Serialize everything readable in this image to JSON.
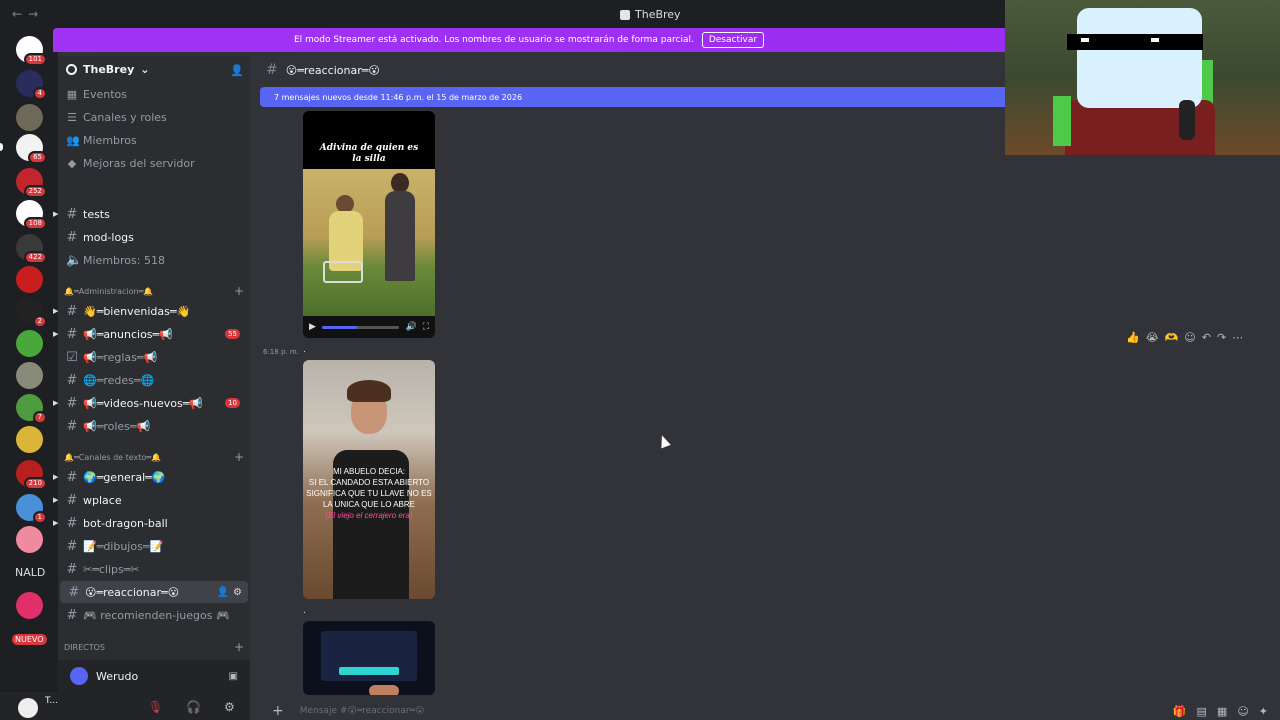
{
  "window": {
    "title": "TheBrey",
    "back_arrow": "←",
    "forward_arrow": "→"
  },
  "banner": {
    "text": "El modo Streamer está activado. Los nombres de usuario se mostrarán de forma parcial.",
    "button": "Desactivar",
    "color": "#a033f4"
  },
  "server": {
    "name": "TheBrey"
  },
  "menu": [
    {
      "label": "Eventos",
      "icon": "calendar-icon"
    },
    {
      "label": "Canales y roles",
      "icon": "list-icon"
    },
    {
      "label": "Miembros",
      "icon": "members-icon"
    },
    {
      "label": "Mejoras del servidor",
      "icon": "boost-icon"
    }
  ],
  "rail": {
    "badges": [
      "101",
      "4",
      "65",
      "252",
      "108",
      "422",
      "2",
      "7",
      "210",
      "1"
    ],
    "nald": "NALD",
    "nuevo": "NUEVO"
  },
  "channels": {
    "tests": "tests",
    "modlogs": "mod-logs",
    "miembros": "Miembros: 518",
    "cat_admin": "🔔═Administracion═🔔",
    "bienvenidas": "👋═bienvenidas═👋",
    "anuncios": "📢═anuncios═📢",
    "anuncios_badge": "55",
    "reglas": "📢═reglas═📢",
    "redes": "🌐═redes═🌐",
    "videos": "📢═videos-nuevos═📢",
    "videos_badge": "10",
    "roles": "📢═roles═📢",
    "cat_texto": "🔔═Canales de texto═🔔",
    "general": "🌍═general═🌍",
    "wplace": "wplace",
    "dragon": "bot-dragon-ball",
    "dibujos": "📝═dibujos═📝",
    "clips": "✂═clips═✂",
    "reaccionar": "😮═reaccionar═😮",
    "juegos": "🎮 recomienden-juegos 🎮",
    "directos": "DIRECTOS"
  },
  "voice": {
    "name": "Werudo"
  },
  "user": {
    "name": "T..."
  },
  "chat": {
    "channel": "😮═reaccionar═😮",
    "new_messages": "7 mensajes nuevos desde 11:46 p.m. el 15 de marzo de 2026",
    "timestamp": "6:18 p. m.",
    "dot": "."
  },
  "video1": {
    "caption_line1": "Adivina de quien es",
    "caption_line2": "la silla",
    "progress": 0.45
  },
  "video2": {
    "line1": "MI ABUELO DECIA:",
    "line2": "SI EL CANDADO ESTA ABIERTO",
    "line3": "SIGNIFICA QUE TU LLAVE NO ES",
    "line4": "LA UNICA QUE LO ABRE",
    "line5": "(El viejo el cerrajero era)"
  },
  "composer": {
    "placeholder": "Mensaje #😮═reaccionar═😮"
  },
  "reactions": [
    "👍",
    "😭",
    "🫶"
  ]
}
